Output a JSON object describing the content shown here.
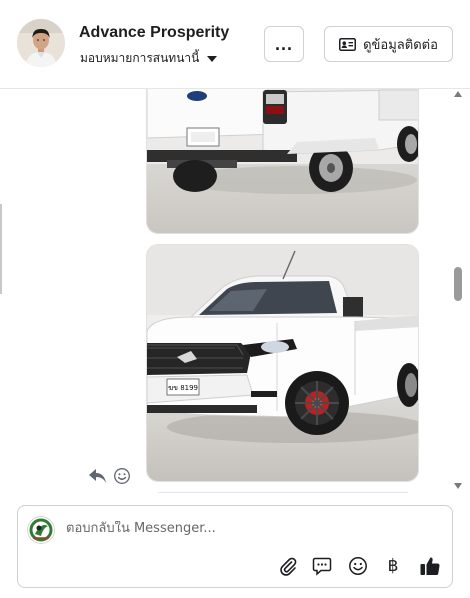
{
  "header": {
    "page_name": "Advance Prosperity",
    "assign_label": "มอบหมายการสนทนานี้",
    "more_label": "...",
    "contact_label": "ดูข้อมูลติดต่อ"
  },
  "thread": {
    "photo1_plate": "",
    "photo2_plate": "ฆข 8199"
  },
  "composer": {
    "placeholder": "ตอบกลับใน Messenger...",
    "currency_label": "฿"
  },
  "icons": [
    "chevron-down-icon",
    "contact-card-icon",
    "reply-icon",
    "emoji-icon",
    "paperclip-icon",
    "chat-bubble-icon",
    "baht-icon",
    "thumbs-up-icon"
  ],
  "colors": {
    "accent": "#1c1e21",
    "border": "#ced0d4",
    "muted": "#65676b"
  }
}
